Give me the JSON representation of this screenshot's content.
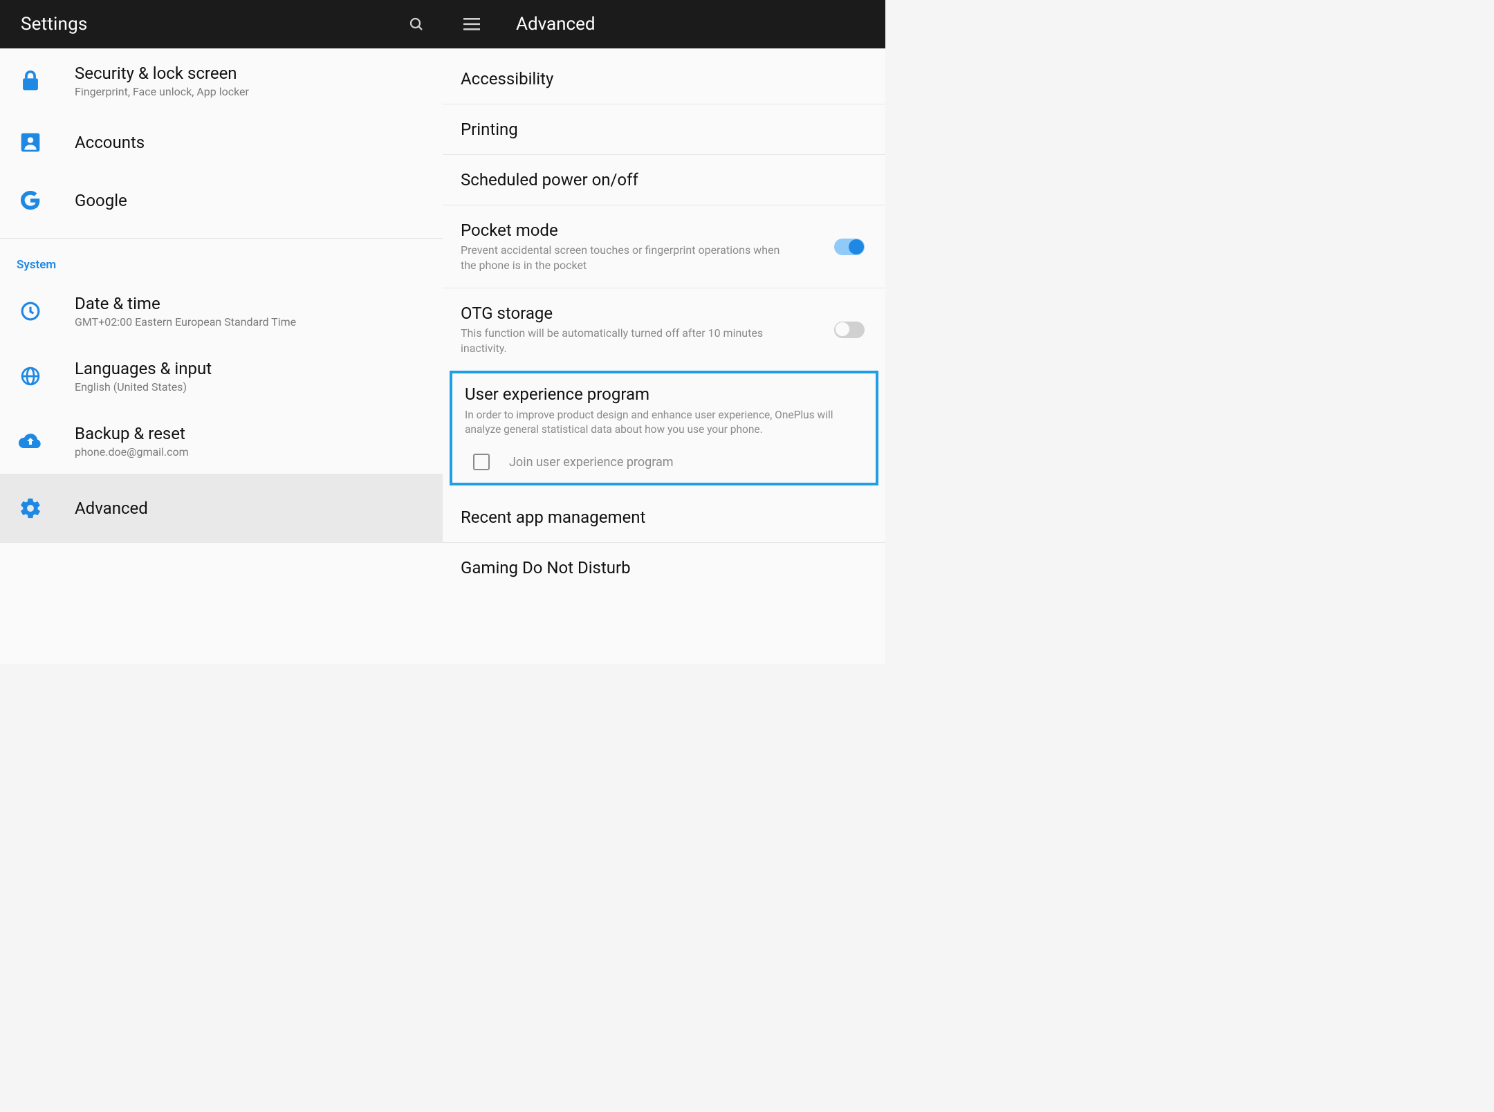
{
  "colors": {
    "accent": "#1e88e5",
    "highlight_border": "#1e9ee6"
  },
  "topbar": {
    "left_title": "Settings",
    "right_title": "Advanced"
  },
  "left_panel": {
    "items": [
      {
        "icon": "lock-icon",
        "title": "Security & lock screen",
        "subtitle": "Fingerprint, Face unlock, App locker"
      },
      {
        "icon": "person-icon",
        "title": "Accounts",
        "subtitle": ""
      },
      {
        "icon": "google-g-icon",
        "title": "Google",
        "subtitle": ""
      }
    ],
    "section_header": "System",
    "system_items": [
      {
        "icon": "clock-icon",
        "title": "Date & time",
        "subtitle": "GMT+02:00 Eastern European Standard Time"
      },
      {
        "icon": "globe-icon",
        "title": "Languages & input",
        "subtitle": "English (United States)"
      },
      {
        "icon": "cloud-upload-icon",
        "title": "Backup & reset",
        "subtitle": "phone.doe@gmail.com"
      },
      {
        "icon": "gear-icon",
        "title": "Advanced",
        "subtitle": "",
        "selected": true
      }
    ]
  },
  "right_panel": {
    "items_top": [
      {
        "title": "Accessibility"
      },
      {
        "title": "Printing"
      },
      {
        "title": "Scheduled power on/off"
      }
    ],
    "pocket_mode": {
      "title": "Pocket mode",
      "subtitle": "Prevent accidental screen touches or fingerprint operations when the phone is in the pocket",
      "toggle_on": true
    },
    "otg_storage": {
      "title": "OTG storage",
      "subtitle": "This function will be automatically turned off after 10 minutes inactivity.",
      "toggle_on": false
    },
    "uep": {
      "title": "User experience program",
      "subtitle": "In order to improve product design and enhance user experience, OnePlus will analyze general statistical data about how you use your phone.",
      "checkbox_checked": false,
      "checkbox_label": "Join user experience program"
    },
    "items_bottom": [
      {
        "title": "Recent app management"
      },
      {
        "title": "Gaming Do Not Disturb"
      }
    ]
  }
}
